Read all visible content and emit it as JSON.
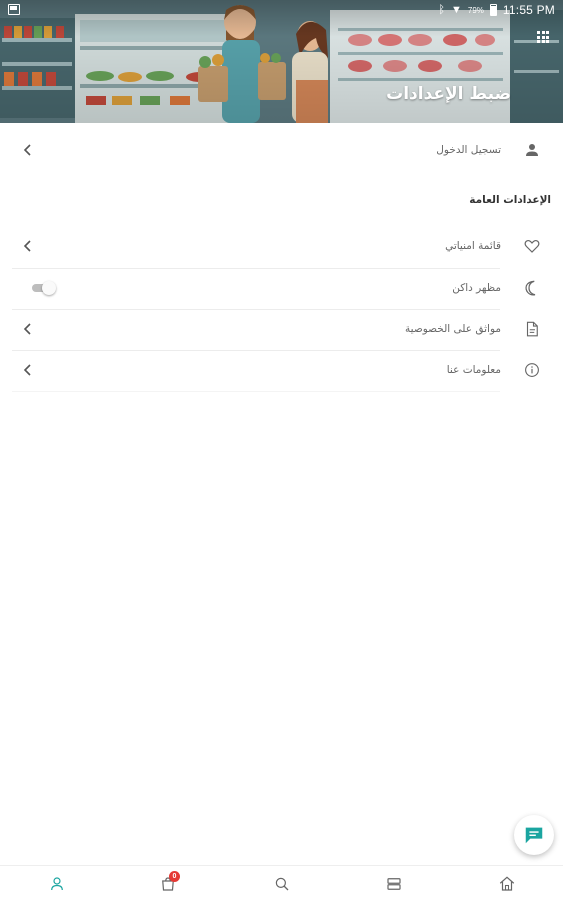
{
  "status_bar": {
    "battery_percent": "79%",
    "time": "11:55 PM",
    "icons": [
      "notification-icon",
      "bluetooth-icon",
      "wifi-icon",
      "battery-icon"
    ]
  },
  "header": {
    "title": "ضبط الإعدادات",
    "background": "supermarket-shoppers-illustration",
    "grid_icon": "apps-grid-icon"
  },
  "login": {
    "label": "تسجيل الدخول",
    "icon": "user-icon"
  },
  "general_settings": {
    "title": "الإعدادات العامة",
    "items": [
      {
        "label": "قائمة امنياتي",
        "icon": "heart-icon",
        "control": "chevron"
      },
      {
        "label": "مظهر داكن",
        "icon": "moon-icon",
        "control": "toggle",
        "toggle_on": false
      },
      {
        "label": "مواثق على الخصوصية",
        "icon": "document-icon",
        "control": "chevron"
      },
      {
        "label": "معلومات عنا",
        "icon": "info-icon",
        "control": "chevron"
      }
    ]
  },
  "fab": {
    "icon": "chat-icon",
    "color": "#1aa5a0"
  },
  "bottom_nav": {
    "items": [
      {
        "icon": "profile-icon",
        "active": true
      },
      {
        "icon": "cart-icon",
        "badge": "0"
      },
      {
        "icon": "search-icon"
      },
      {
        "icon": "categories-icon"
      },
      {
        "icon": "home-icon"
      }
    ]
  },
  "colors": {
    "accent": "#1aa5a0",
    "badge": "#e53935",
    "text": "#666666"
  }
}
